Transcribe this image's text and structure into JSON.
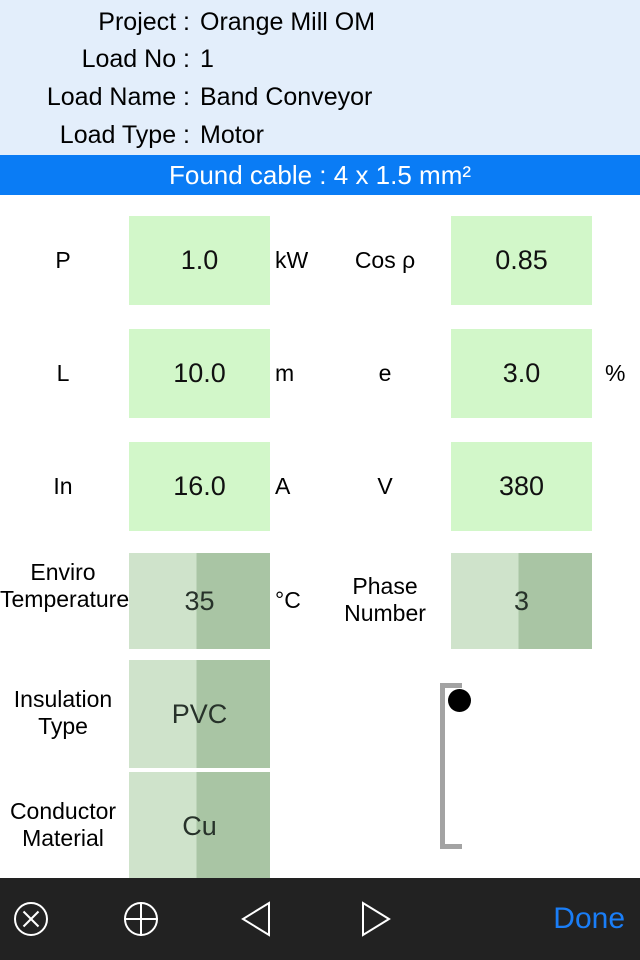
{
  "header": {
    "rows": [
      {
        "label": "Project :",
        "value": "Orange Mill  OM"
      },
      {
        "label": "Load No :",
        "value": "1"
      },
      {
        "label": "Load Name :",
        "value": "Band Conveyor"
      },
      {
        "label": "Load Type :",
        "value": "Motor"
      }
    ],
    "background_color": "#e3eefb"
  },
  "banner": {
    "text": "Found cable : 4 x 1.5 mm²",
    "background_color": "#0a7cf5",
    "text_color": "#ffffff"
  },
  "form": {
    "rows": [
      {
        "left_label": "P",
        "left_value": "1.0",
        "left_unit": "kW",
        "left_style": "editable",
        "mid_label": "Cos ρ",
        "right_value": "0.85",
        "right_unit": "",
        "right_style": "editable"
      },
      {
        "left_label": "L",
        "left_value": "10.0",
        "left_unit": "m",
        "left_style": "editable",
        "mid_label": "e",
        "right_value": "3.0",
        "right_unit": "%",
        "right_style": "editable"
      },
      {
        "left_label": "In",
        "left_value": "16.0",
        "left_unit": "A",
        "left_style": "editable",
        "mid_label": "V",
        "right_value": "380",
        "right_unit": "",
        "right_style": "editable"
      },
      {
        "left_label": "Enviro Temperature",
        "left_value": "35",
        "left_unit": "°C",
        "left_style": "split",
        "mid_label": "Phase Number",
        "right_value": "3",
        "right_unit": "",
        "right_style": "split"
      },
      {
        "left_label": "Insulation Type",
        "left_value": "PVC",
        "left_unit": "",
        "left_style": "split",
        "mid_label": "",
        "right_value": "",
        "right_unit": "",
        "right_style": "none"
      },
      {
        "left_label": "Conductor Material",
        "left_value": "Cu",
        "left_unit": "",
        "left_style": "split",
        "mid_label": "",
        "right_value": "",
        "right_unit": "",
        "right_style": "none"
      }
    ],
    "editable_field_color": "#d2f7c9",
    "split_field_left_color": "#cfe3cb",
    "split_field_right_color": "#a9c5a4"
  },
  "slider": {
    "name": "vertical-slider",
    "thumb_position": "top",
    "track_color": "#a3a3a3",
    "thumb_color": "#000000"
  },
  "toolbar": {
    "background_color": "#222222",
    "close_icon": "circle-x-icon",
    "target_icon": "circle-plus-icon",
    "prev_icon": "triangle-left-icon",
    "next_icon": "triangle-right-icon",
    "done_label": "Done",
    "done_color": "#1a7ef7"
  }
}
